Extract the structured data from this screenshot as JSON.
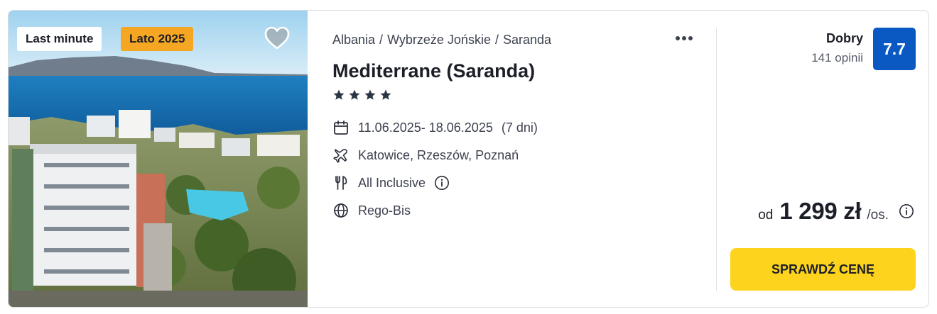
{
  "badges": {
    "last_minute": "Last minute",
    "season": "Lato 2025"
  },
  "breadcrumb": {
    "country": "Albania",
    "region": "Wybrzeże Jońskie",
    "city": "Saranda",
    "separator": "/"
  },
  "hotel": {
    "name": "Mediterrane (Saranda)",
    "stars": 4
  },
  "trip": {
    "dates": "11.06.2025- 18.06.2025",
    "duration": "(7 dni)",
    "airports": "Katowice, Rzeszów, Poznań",
    "board": "All Inclusive",
    "operator": "Rego-Bis"
  },
  "rating": {
    "label": "Dobry",
    "reviews": "141 opinii",
    "score": "7.7"
  },
  "price": {
    "prefix": "od",
    "amount": "1 299 zł",
    "suffix": "/os."
  },
  "cta_label": "SPRAWDŹ CENĘ",
  "icons": {
    "favorite": "heart-icon",
    "more": "more-dots-icon",
    "dates": "calendar-icon",
    "airports": "plane-icon",
    "board": "cutlery-icon",
    "operator": "globe-icon",
    "info": "info-icon",
    "star": "star-icon"
  },
  "colors": {
    "season_badge": "#f5a623",
    "score_badge": "#0a58c2",
    "cta": "#fdd31d"
  }
}
